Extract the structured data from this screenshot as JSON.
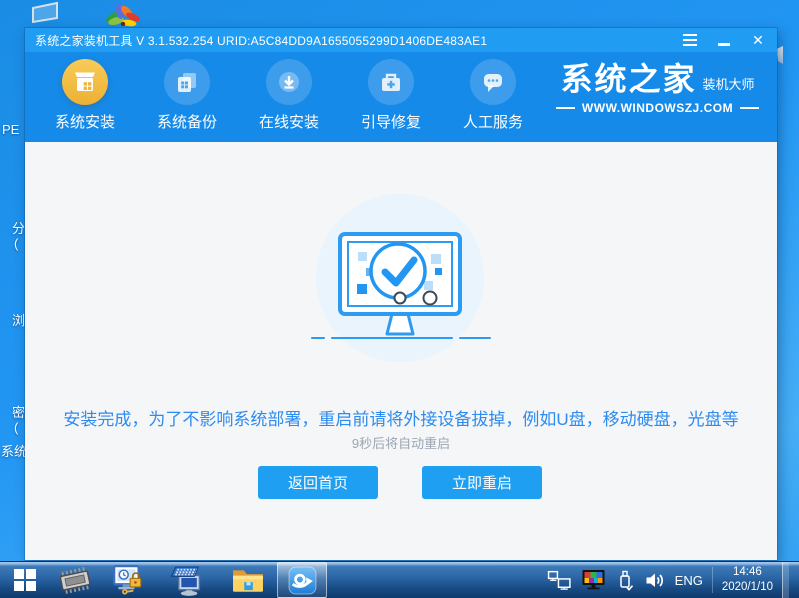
{
  "colors": {
    "titlebar": "#219cf3",
    "navbar": "#168ae9",
    "accent_button": "#1e9ff2",
    "active_nav_gold": "#f2bc42",
    "message_blue": "#2e8bf0",
    "content_bg": "#f4f6f8",
    "desktop_blue": "#2196f3",
    "taskbar_navy": "#0f3a6c"
  },
  "window": {
    "title": "系统之家装机工具 V 3.1.532.254 URID:A5C84DD9A1655055299D1406DE483AE1",
    "nav": [
      {
        "label": "系统安装",
        "icon": "install-box-icon",
        "active": true
      },
      {
        "label": "系统备份",
        "icon": "backup-copies-icon",
        "active": false
      },
      {
        "label": "在线安装",
        "icon": "online-download-icon",
        "active": false
      },
      {
        "label": "引导修复",
        "icon": "boot-repair-toolbox-icon",
        "active": false
      },
      {
        "label": "人工服务",
        "icon": "support-chat-icon",
        "active": false
      }
    ],
    "brand": {
      "title": "系统之家",
      "subtitle": "装机大师",
      "website": "WWW.WINDOWSZJ.COM"
    },
    "main": {
      "message": "安装完成，为了不影响系统部署，重启前请将外接设备拔掉，例如U盘，移动硬盘，光盘等",
      "countdown": "9秒后将自动重启",
      "buttons": [
        {
          "label": "返回首页"
        },
        {
          "label": "立即重启"
        }
      ]
    }
  },
  "desktop": {
    "partial_icon_labels": [
      {
        "text": "PE"
      },
      {
        "text": "分"
      },
      {
        "text": "("
      },
      {
        "text": "浏"
      },
      {
        "text": "密"
      },
      {
        "text": "("
      },
      {
        "text": "系统"
      }
    ]
  },
  "taskbar": {
    "tray": {
      "language": "ENG",
      "time": "14:46",
      "date": "2020/1/10"
    }
  }
}
